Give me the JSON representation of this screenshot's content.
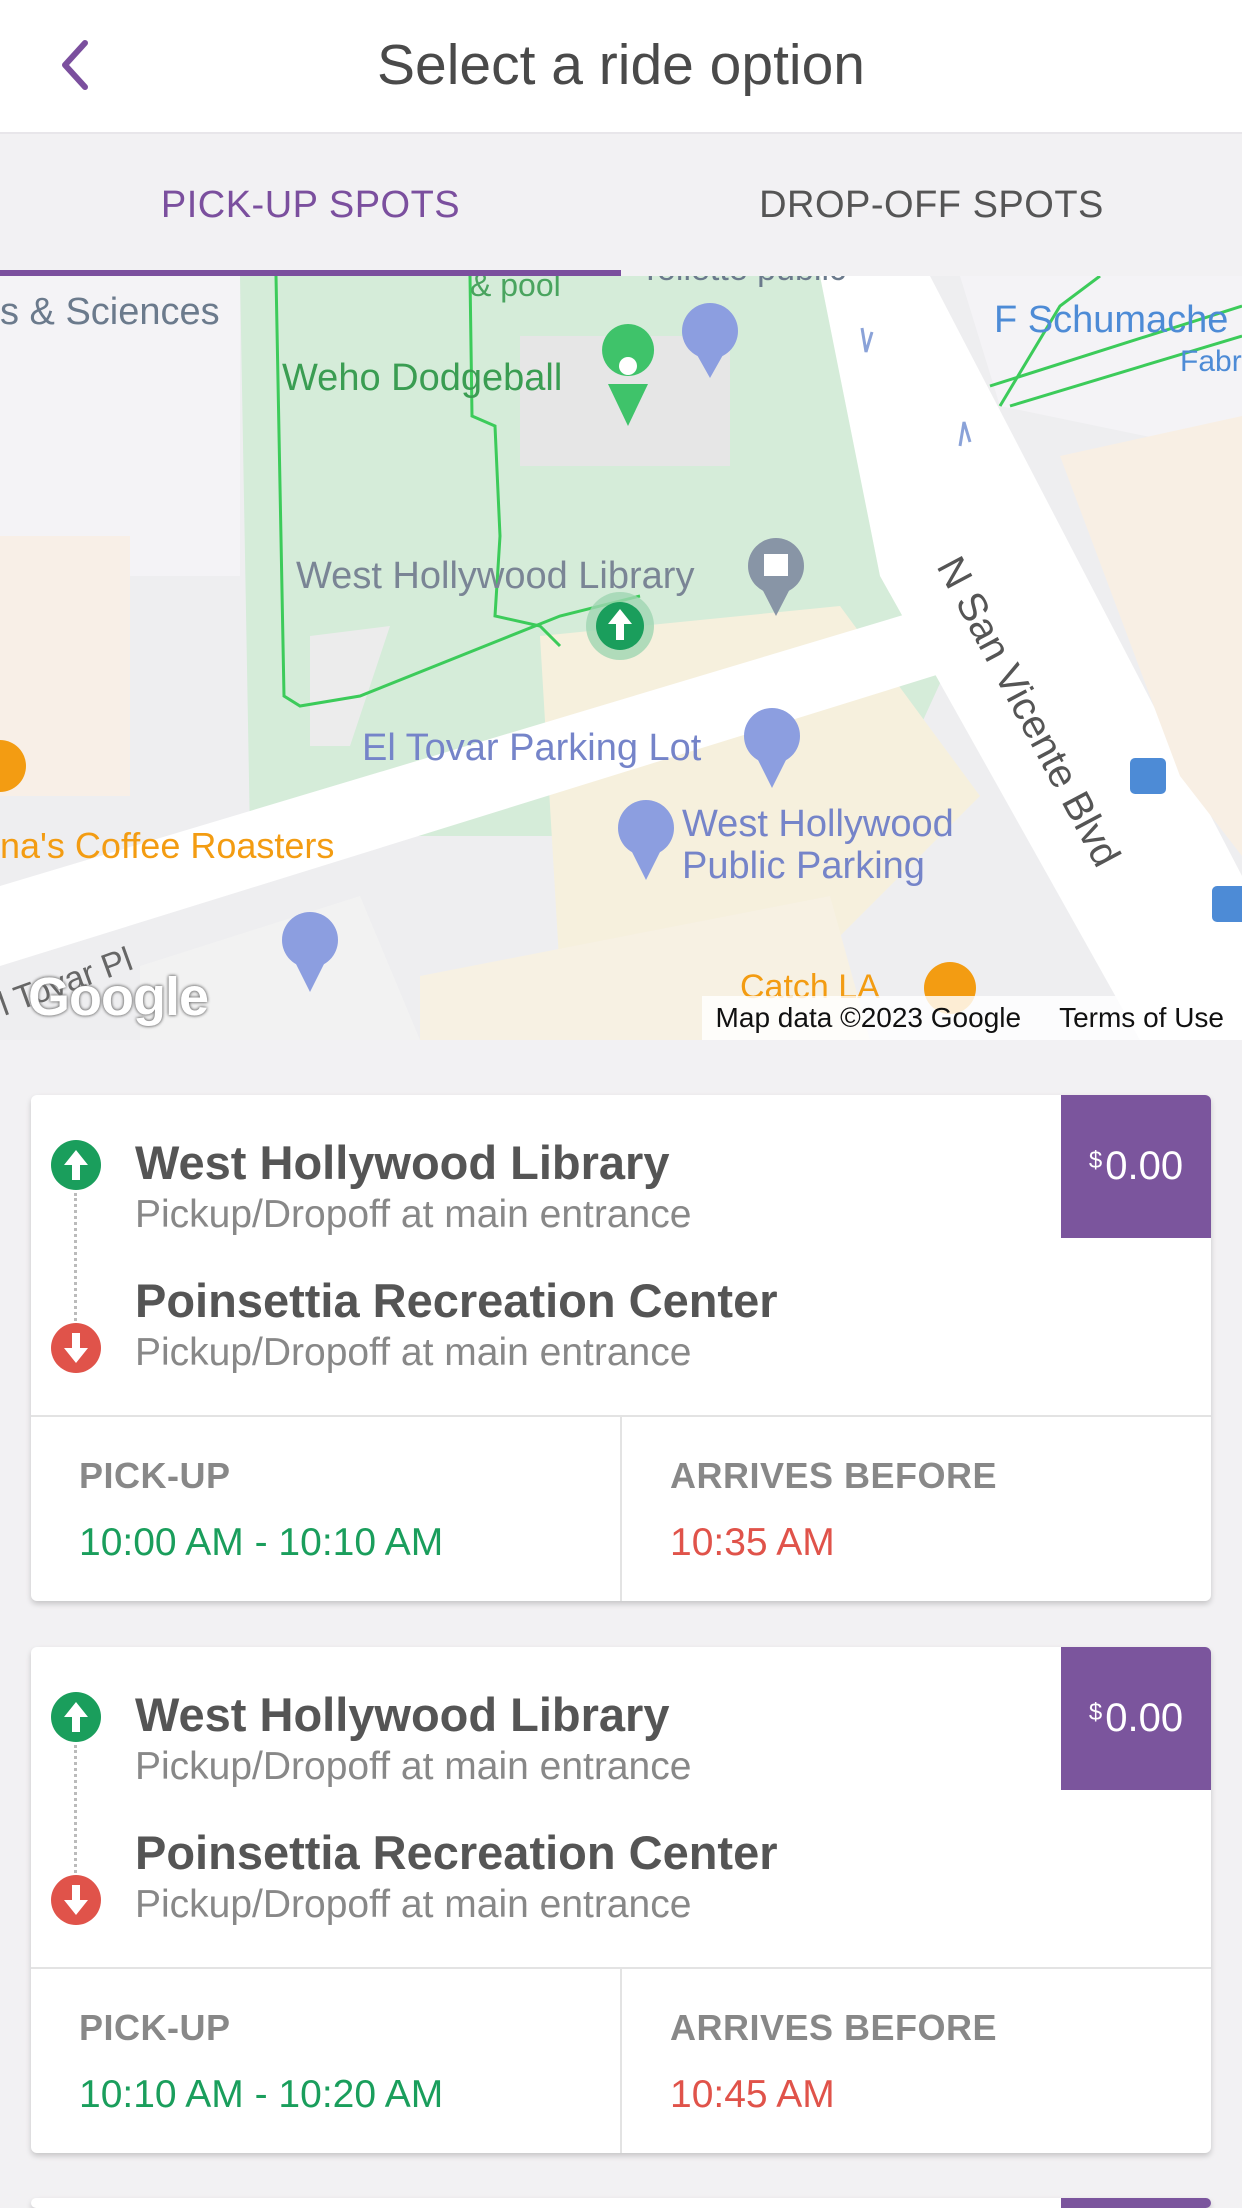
{
  "header": {
    "title": "Select a ride option"
  },
  "tabs": [
    {
      "label": "PICK-UP SPOTS",
      "active": true
    },
    {
      "label": "DROP-OFF SPOTS",
      "active": false
    }
  ],
  "map": {
    "labels": {
      "sciences": "s & Sciences",
      "pool": "& pool",
      "park_public": "Tollette public",
      "dodgeball": "Weho Dodgeball",
      "schumacher": "F Schumache",
      "fabr": "Fabr",
      "library": "West Hollywood Library",
      "street": "N San Vicente Blvd",
      "parking_lot": "El Tovar Parking Lot",
      "public_parking_1": "West Hollywood",
      "public_parking_2": "Public Parking",
      "coffee": "na's Coffee Roasters",
      "tovar": "l Tovar Pl",
      "catch": "Catch LA"
    },
    "google_logo": "Google",
    "attribution": "Map data ©2023 Google",
    "terms": "Terms of Use",
    "colors": {
      "green_path": "#3ccb5a",
      "pickup_marker": "#1a9e5c",
      "parking_marker": "#8c9ee0",
      "cafe": "#f39c12"
    }
  },
  "rides": [
    {
      "pickup_name": "West Hollywood Library",
      "pickup_sub": "Pickup/Dropoff at main entrance",
      "dropoff_name": "Poinsettia Recreation Center",
      "dropoff_sub": "Pickup/Dropoff at main entrance",
      "price_symbol": "$",
      "price": "0.00",
      "pickup_label": "PICK-UP",
      "pickup_window": "10:00 AM - 10:10 AM",
      "arrives_label": "ARRIVES BEFORE",
      "arrives_time": "10:35 AM"
    },
    {
      "pickup_name": "West Hollywood Library",
      "pickup_sub": "Pickup/Dropoff at main entrance",
      "dropoff_name": "Poinsettia Recreation Center",
      "dropoff_sub": "Pickup/Dropoff at main entrance",
      "price_symbol": "$",
      "price": "0.00",
      "pickup_label": "PICK-UP",
      "pickup_window": "10:10 AM - 10:20 AM",
      "arrives_label": "ARRIVES BEFORE",
      "arrives_time": "10:45 AM"
    }
  ],
  "colors": {
    "accent": "#7b4f9e",
    "green": "#1a9e5c",
    "red": "#e0534a"
  }
}
